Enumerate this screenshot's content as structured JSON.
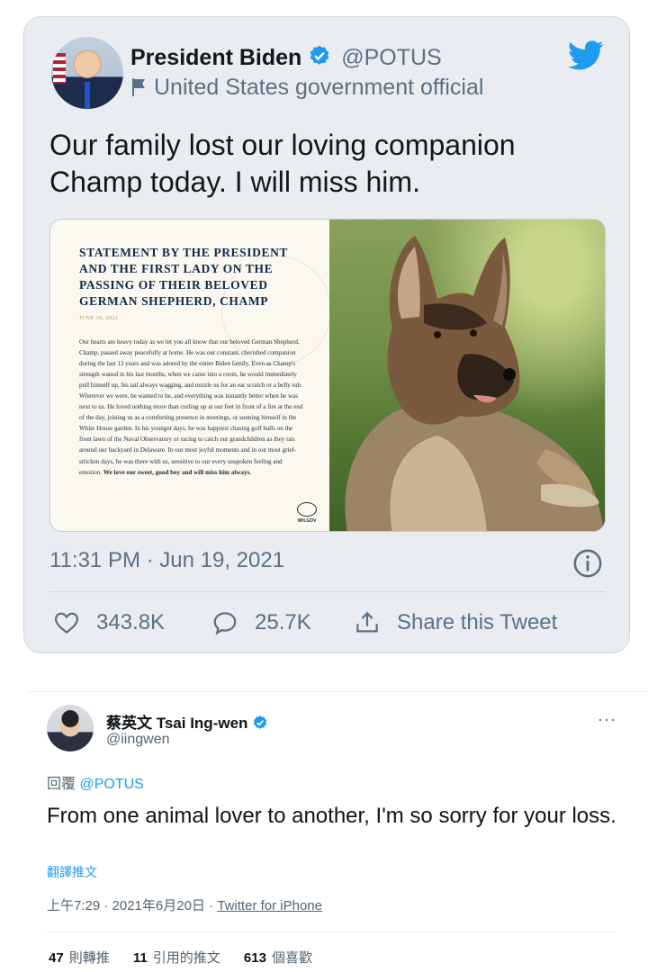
{
  "tweet1": {
    "name": "President Biden",
    "handle": "@POTUS",
    "label": "United States government official",
    "text": "Our family lost our loving companion Champ today. I will miss him.",
    "statement": {
      "title": "Statement by the President and the First Lady on the Passing of their Beloved German Shepherd, Champ",
      "date": "JUNE 19, 2021",
      "body": "Our hearts are heavy today as we let you all know that our beloved German Shepherd, Champ, passed away peacefully at home. He was our constant, cherished companion during the last 13 years and was adored by the entire Biden family. Even as Champ's strength waned in his last months, when we came into a room, he would immediately pull himself up, his tail always wagging, and nuzzle us for an ear scratch or a belly rub. Wherever we were, he wanted to be, and everything was instantly better when he was next to us. He loved nothing more than curling up at our feet in front of a fire at the end of the day, joining us as a comforting presence in meetings, or sunning himself in the White House garden. In his younger days, he was happiest chasing golf balls on the front lawn of the Naval Observatory or racing to catch our grandchildren as they ran around our backyard in Delaware. In our most joyful moments and in our most grief-stricken days, he was there with us, sensitive to our every unspoken feeling and emotion.",
      "closing": "We love our sweet, good boy and will miss him always.",
      "logo_text": "WH.GOV"
    },
    "timestamp": "11:31 PM · Jun 19, 2021",
    "likes": "343.8K",
    "replies": "25.7K",
    "share": "Share this Tweet",
    "icons": {
      "verified": "verified-badge-icon",
      "flag": "flag-icon",
      "bird": "twitter-bird-icon",
      "info": "info-icon",
      "heart": "heart-icon",
      "reply": "reply-icon",
      "share": "share-icon"
    },
    "colors": {
      "brand": "#1d9bf0",
      "muted": "#5b7083"
    }
  },
  "tweet2": {
    "name": "蔡英文 Tsai Ing-wen",
    "handle": "@iingwen",
    "reply_prefix": "回覆",
    "reply_to": "@POTUS",
    "text": "From one animal lover to another, I'm so sorry for your loss.",
    "translate": "翻譯推文",
    "time": "上午7:29 · 2021年6月20日 · ",
    "source": "Twitter for iPhone",
    "retweets_count": "47",
    "retweets_label": "則轉推",
    "quotes_count": "11",
    "quotes_label": "引用的推文",
    "likes_count": "613",
    "likes_label": "個喜歡",
    "more": "···"
  }
}
